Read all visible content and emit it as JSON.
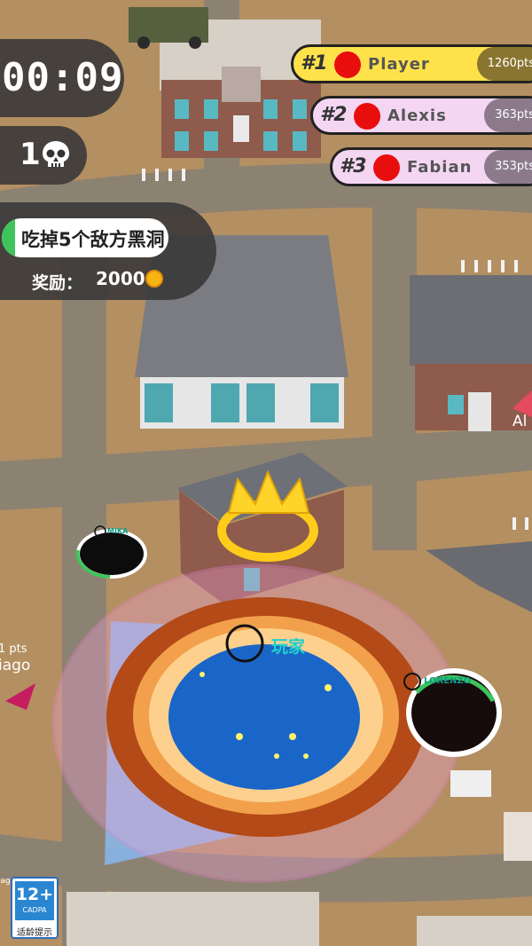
{
  "hud": {
    "timer": "00:09",
    "kills": "1",
    "kills_icon": "skull-icon",
    "mission_text": "吃掉5个敌方黑洞",
    "mission_progress": 0.08,
    "reward_label": "奖励：",
    "reward_value": "2000",
    "reward_icon": "coin-icon"
  },
  "leaderboard": [
    {
      "rank": "#1",
      "name": "Player",
      "points": "1260pts",
      "bg": "#ffe24a"
    },
    {
      "rank": "#2",
      "name": "Alexis",
      "points": "363pts",
      "bg": "#f4d6f2"
    },
    {
      "rank": "#3",
      "name": "Fabian",
      "points": "353pts",
      "bg": "#f4d6f2"
    }
  ],
  "world": {
    "player_label": "玩家",
    "enemy_label_1": "LORENZO",
    "enemy_label_2": "MIKA",
    "offscreen_left_pts": "1 pts",
    "offscreen_left_name": "iago",
    "offscreen_right_name": "Al",
    "offscreen_bottom_name": "iago"
  },
  "age_rating": {
    "label": "12+",
    "org": "CADPA",
    "caption": "适龄提示"
  },
  "colors": {
    "ground": "#b48f61",
    "road": "#8a8070",
    "hud_bg": "#373737",
    "mission_fill": "#3ec45a",
    "player_dot": "#e80e0e"
  }
}
